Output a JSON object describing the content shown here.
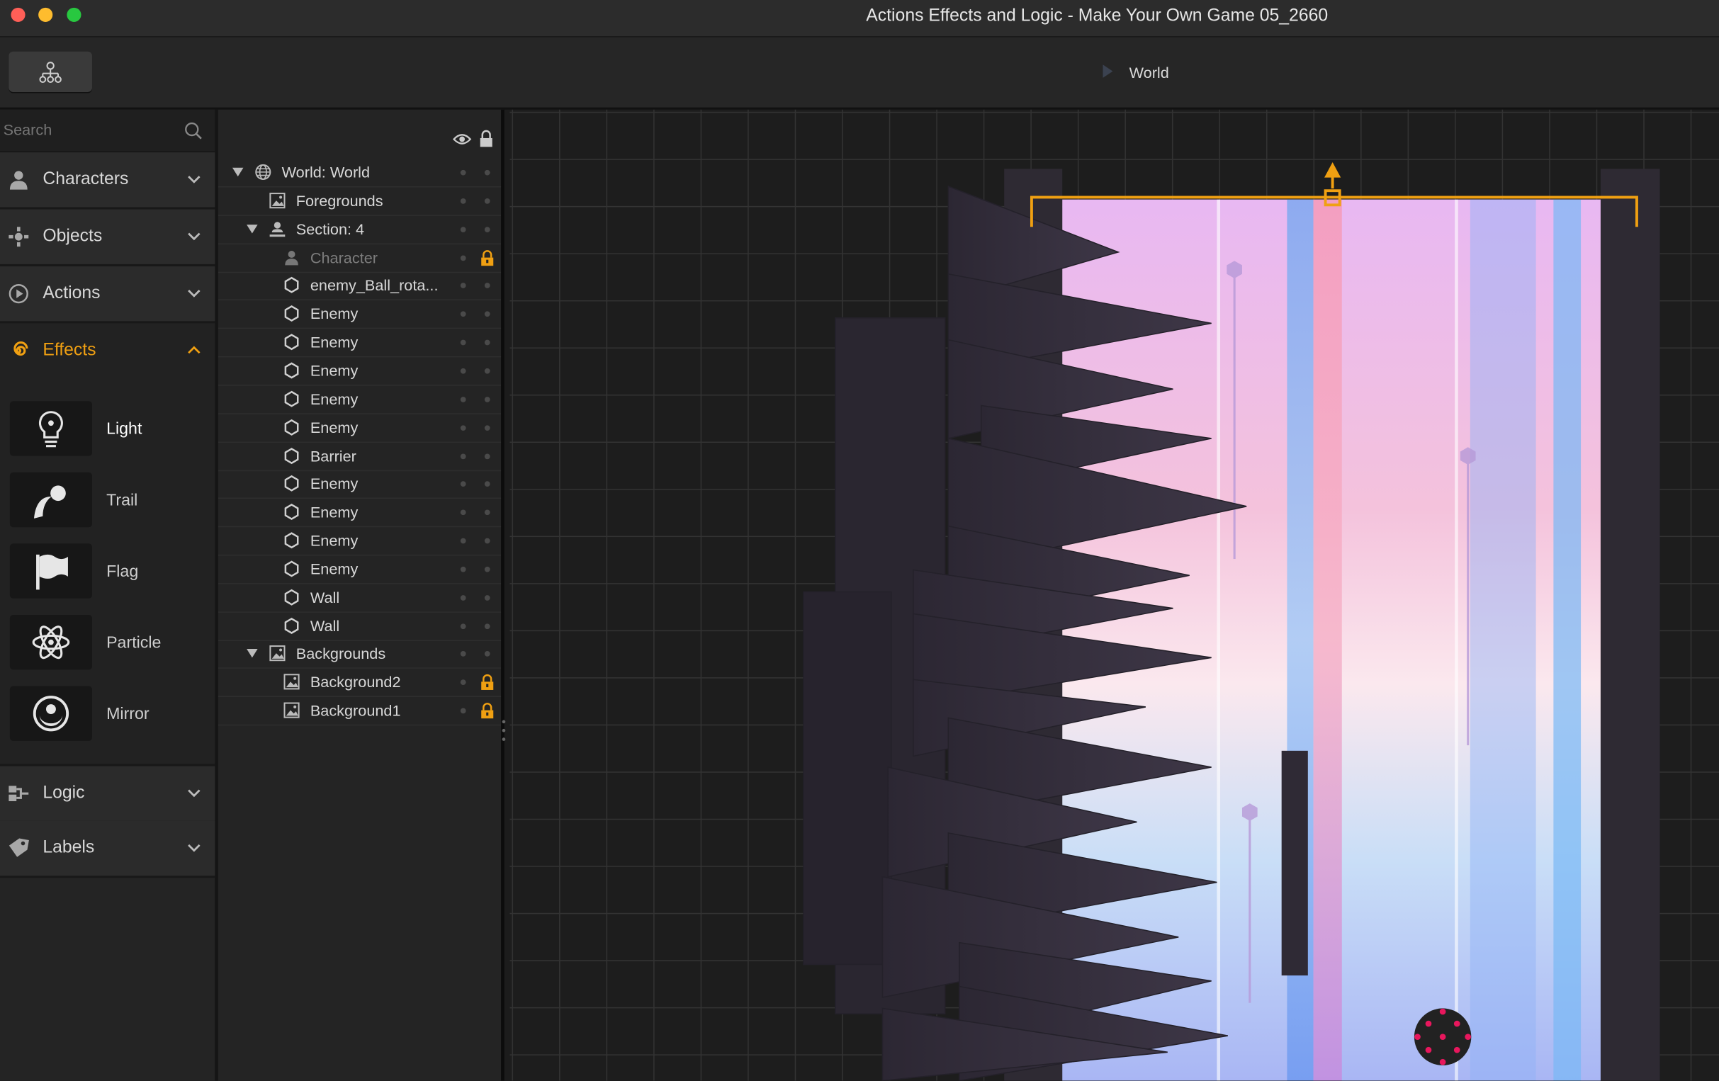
{
  "window": {
    "title": "Actions Effects and Logic - Make Your Own Game 05_2660"
  },
  "toolbar": {
    "hierarchy_button_icon": "hierarchy-icon",
    "breadcrumb": "World"
  },
  "search": {
    "placeholder": "Search"
  },
  "categories": [
    {
      "label": "Characters",
      "icon": "person-icon",
      "expanded": false
    },
    {
      "label": "Objects",
      "icon": "objects-icon",
      "expanded": false
    },
    {
      "label": "Actions",
      "icon": "play-icon",
      "expanded": false
    },
    {
      "label": "Effects",
      "icon": "spiral-icon",
      "expanded": true
    },
    {
      "label": "Logic",
      "icon": "logic-icon",
      "expanded": false
    },
    {
      "label": "Labels",
      "icon": "tag-icon",
      "expanded": false
    }
  ],
  "effects": [
    {
      "label": "Light",
      "icon": "lightbulb-icon"
    },
    {
      "label": "Trail",
      "icon": "trail-icon"
    },
    {
      "label": "Flag",
      "icon": "flag-icon"
    },
    {
      "label": "Particle",
      "icon": "atom-icon"
    },
    {
      "label": "Mirror",
      "icon": "mirror-icon"
    }
  ],
  "layers": [
    {
      "name": "World: World",
      "indent": 0,
      "icon": "globe-icon",
      "toggle": true,
      "locked": false,
      "dim": false
    },
    {
      "name": "Foregrounds",
      "indent": 1,
      "icon": "image-icon",
      "toggle": false,
      "locked": false,
      "dim": false
    },
    {
      "name": "Section: 4",
      "indent": 1,
      "icon": "section-icon",
      "toggle": true,
      "locked": false,
      "dim": false
    },
    {
      "name": "Character",
      "indent": 2,
      "icon": "person-icon",
      "toggle": false,
      "locked": true,
      "dim": true
    },
    {
      "name": "enemy_Ball_rota...",
      "indent": 2,
      "icon": "hexagon-icon",
      "toggle": false,
      "locked": false,
      "dim": false
    },
    {
      "name": "Enemy",
      "indent": 2,
      "icon": "hexagon-icon",
      "toggle": false,
      "locked": false,
      "dim": false
    },
    {
      "name": "Enemy",
      "indent": 2,
      "icon": "hexagon-icon",
      "toggle": false,
      "locked": false,
      "dim": false
    },
    {
      "name": "Enemy",
      "indent": 2,
      "icon": "hexagon-icon",
      "toggle": false,
      "locked": false,
      "dim": false
    },
    {
      "name": "Enemy",
      "indent": 2,
      "icon": "hexagon-icon",
      "toggle": false,
      "locked": false,
      "dim": false
    },
    {
      "name": "Enemy",
      "indent": 2,
      "icon": "hexagon-icon",
      "toggle": false,
      "locked": false,
      "dim": false
    },
    {
      "name": "Barrier",
      "indent": 2,
      "icon": "hexagon-icon",
      "toggle": false,
      "locked": false,
      "dim": false
    },
    {
      "name": "Enemy",
      "indent": 2,
      "icon": "hexagon-icon",
      "toggle": false,
      "locked": false,
      "dim": false
    },
    {
      "name": "Enemy",
      "indent": 2,
      "icon": "hexagon-icon",
      "toggle": false,
      "locked": false,
      "dim": false
    },
    {
      "name": "Enemy",
      "indent": 2,
      "icon": "hexagon-icon",
      "toggle": false,
      "locked": false,
      "dim": false
    },
    {
      "name": "Enemy",
      "indent": 2,
      "icon": "hexagon-icon",
      "toggle": false,
      "locked": false,
      "dim": false
    },
    {
      "name": "Wall",
      "indent": 2,
      "icon": "hexagon-icon",
      "toggle": false,
      "locked": false,
      "dim": false
    },
    {
      "name": "Wall",
      "indent": 2,
      "icon": "hexagon-icon",
      "toggle": false,
      "locked": false,
      "dim": false
    },
    {
      "name": "Backgrounds",
      "indent": 1,
      "icon": "image-icon",
      "toggle": true,
      "locked": false,
      "dim": false
    },
    {
      "name": "Background2",
      "indent": 2,
      "icon": "image-icon",
      "toggle": false,
      "locked": true,
      "dim": false
    },
    {
      "name": "Background1",
      "indent": 2,
      "icon": "image-icon",
      "toggle": false,
      "locked": true,
      "dim": false
    }
  ],
  "colors": {
    "accent": "#f0a012",
    "enemy": "#e8175d",
    "panel": "#242424"
  }
}
